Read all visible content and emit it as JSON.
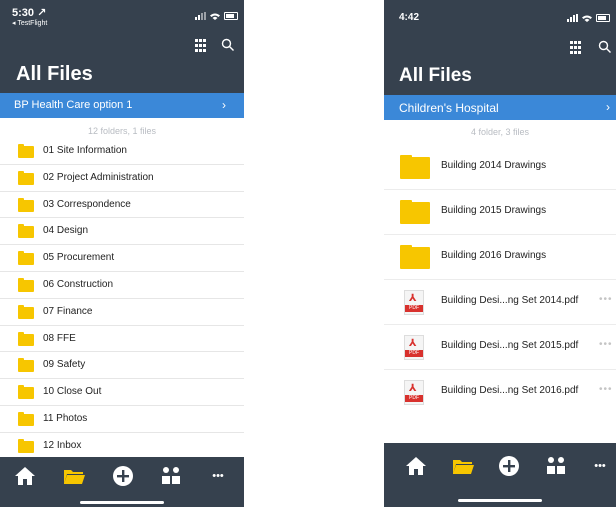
{
  "left": {
    "status": {
      "time": "5:30 ↗",
      "back_label": "◂ TestFlight"
    },
    "title": "All Files",
    "banner": {
      "label": "BP Health Care option 1",
      "chevron": "›"
    },
    "count_text": "12 folders, 1 files",
    "items": [
      {
        "name": "01 Site Information",
        "icon": "folder-icon"
      },
      {
        "name": "02 Project Administration",
        "icon": "folder-icon"
      },
      {
        "name": "03 Correspondence",
        "icon": "folder-icon"
      },
      {
        "name": "04 Design",
        "icon": "folder-icon"
      },
      {
        "name": "05 Procurement",
        "icon": "folder-icon"
      },
      {
        "name": "06 Construction",
        "icon": "folder-icon"
      },
      {
        "name": "07 Finance",
        "icon": "folder-icon"
      },
      {
        "name": "08 FFE",
        "icon": "folder-icon"
      },
      {
        "name": "09 Safety",
        "icon": "folder-icon"
      },
      {
        "name": "10 Close Out",
        "icon": "folder-icon"
      },
      {
        "name": "11 Photos",
        "icon": "folder-icon"
      },
      {
        "name": "12 Inbox",
        "icon": "folder-icon"
      }
    ]
  },
  "right": {
    "status": {
      "time": "4:42"
    },
    "title": "All Files",
    "banner": {
      "label": "Children's Hospital",
      "chevron": "›"
    },
    "count_text": "4 folder, 3 files",
    "items": [
      {
        "name": "Building 2014 Drawings",
        "icon": "folder-icon"
      },
      {
        "name": "Building 2015 Drawings",
        "icon": "folder-icon"
      },
      {
        "name": "Building 2016 Drawings",
        "icon": "folder-icon"
      },
      {
        "name": "Building Desi...ng Set 2014.pdf",
        "icon": "pdf-icon",
        "more": "•••"
      },
      {
        "name": "Building Desi...ng Set 2015.pdf",
        "icon": "pdf-icon",
        "more": "•••"
      },
      {
        "name": "Building Desi...ng Set 2016.pdf",
        "icon": "pdf-icon",
        "more": "•••"
      }
    ],
    "pdf_tag": "PDF"
  },
  "tabbar": {
    "tabs": [
      "home-icon",
      "folder-icon",
      "add-icon",
      "apps-icon",
      "more-icon"
    ],
    "more_glyph": "•••"
  },
  "colors": {
    "header": "#36414e",
    "banner": "#3b88d8",
    "folder": "#f7c600",
    "active_tab": "#f7c600",
    "pdf_red": "#d8312d"
  }
}
